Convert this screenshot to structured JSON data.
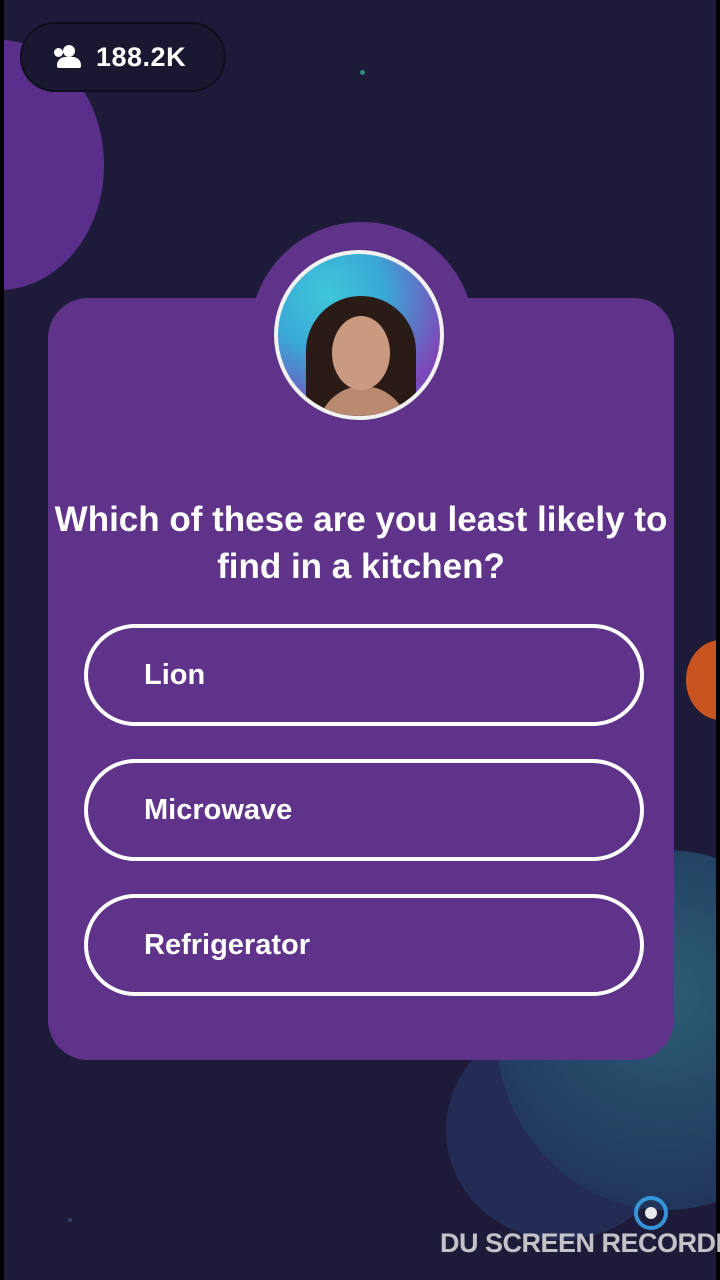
{
  "header": {
    "viewer_icon": "people-icon",
    "viewer_count": "188.2K"
  },
  "host": {
    "avatar": "host-avatar-photo"
  },
  "question": {
    "text": "Which of these are you least likely to find in a kitchen?",
    "options": [
      {
        "label": "Lion"
      },
      {
        "label": "Microwave"
      },
      {
        "label": "Refrigerator"
      }
    ]
  },
  "watermark": {
    "text": "DU SCREEN RECORDER",
    "logo_icon": "du-recorder-logo-icon"
  },
  "colors": {
    "background": "#1e1b3a",
    "card": "#5e3389",
    "option_border": "#ffffff",
    "text": "#ffffff"
  }
}
